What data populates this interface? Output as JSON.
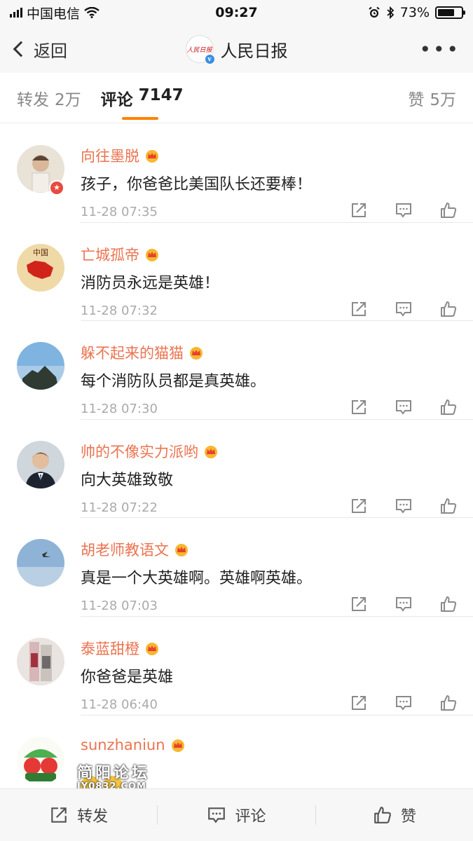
{
  "status": {
    "carrier": "中国电信",
    "time": "09:27",
    "battery": "73%",
    "battery_level": 0.73
  },
  "nav": {
    "back_label": "返回",
    "title": "人民日报",
    "logo_text": "人民日报",
    "more_label": "•••"
  },
  "tabs": [
    {
      "label": "转发",
      "count": "2万"
    },
    {
      "label": "评论",
      "count": "7147"
    },
    {
      "label": "赞",
      "count": "5万"
    }
  ],
  "comments": [
    {
      "name": "向往墨脱",
      "text": "孩子，你爸爸比美国队长还要棒！",
      "time": "11-28 07:35"
    },
    {
      "name": "亡城孤帝",
      "text": "消防员永远是英雄！",
      "time": "11-28 07:32"
    },
    {
      "name": "躲不起来的猫猫",
      "text": "每个消防队员都是真英雄。",
      "time": "11-28 07:30"
    },
    {
      "name": "帅的不像实力派哟",
      "text": "向大英雄致敬",
      "time": "11-28 07:22"
    },
    {
      "name": "胡老师教语文",
      "text": "真是一个大英雄啊。英雄啊英雄。",
      "time": "11-28 07:03"
    },
    {
      "name": "泰蓝甜橙",
      "text": "你爸爸是英雄",
      "time": "11-28 06:40"
    },
    {
      "name": "sunzhaniun"
    }
  ],
  "bottom": {
    "repost_label": "转发",
    "comment_label": "评论",
    "like_label": "赞"
  },
  "watermark": {
    "line1": "简阳论坛",
    "line2": "JY0832.COM"
  },
  "colors": {
    "accent": "#ff8200",
    "username": "#eb7350",
    "vip_badge": "#e84a3d",
    "verified": "#3a8ee6"
  }
}
